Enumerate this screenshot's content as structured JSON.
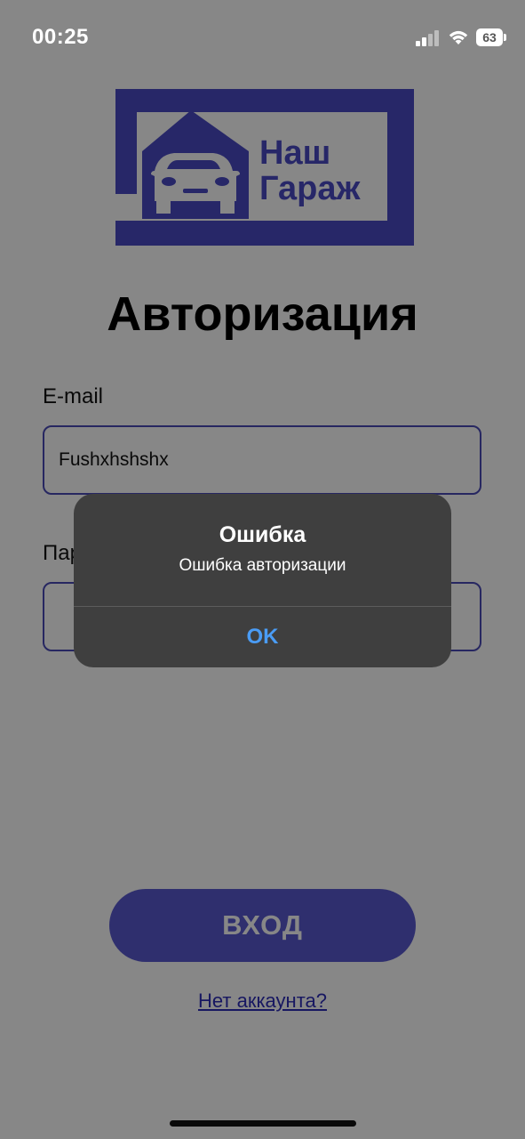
{
  "status_bar": {
    "time": "00:25",
    "battery": "63"
  },
  "logo": {
    "line1": "Наш",
    "line2": "Гараж",
    "brand_color": "#4b4bc4"
  },
  "login": {
    "title": "Авторизация",
    "email_label": "E-mail",
    "email_value": "Fushxhshshx",
    "password_label": "Пароль",
    "password_value": "",
    "login_button": "ВХОД",
    "no_account_link": "Нет аккаунта?"
  },
  "alert": {
    "title": "Ошибка",
    "message": "Ошибка авторизации",
    "ok_button": "OK"
  },
  "colors": {
    "accent": "#5a5ad0",
    "overlay": "#878787",
    "dialog_bg": "#3f3f3f",
    "ok_blue": "#4a9cf5"
  }
}
